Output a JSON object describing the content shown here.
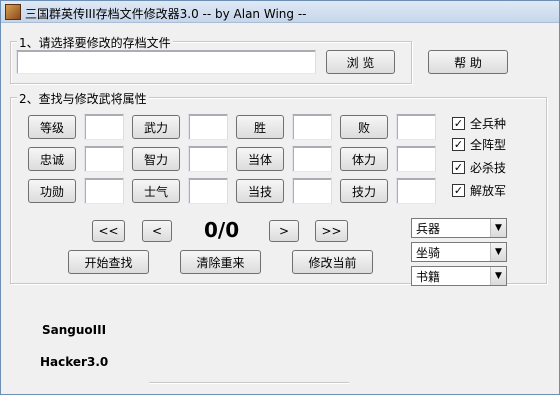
{
  "window": {
    "title": "三国群英传III存档文件修改器3.0 -- by Alan Wing --"
  },
  "file_group": {
    "legend": "1、请选择要修改的存档文件",
    "path_value": "",
    "browse_label": "浏 览",
    "help_label": "帮 助"
  },
  "search_group": {
    "legend": "2、查找与修改武将属性",
    "fields": [
      {
        "label": "等级",
        "value": ""
      },
      {
        "label": "武力",
        "value": ""
      },
      {
        "label": "胜",
        "value": ""
      },
      {
        "label": "败",
        "value": ""
      },
      {
        "label": "忠诚",
        "value": ""
      },
      {
        "label": "智力",
        "value": ""
      },
      {
        "label": "当体",
        "value": ""
      },
      {
        "label": "体力",
        "value": ""
      },
      {
        "label": "功勋",
        "value": ""
      },
      {
        "label": "士气",
        "value": ""
      },
      {
        "label": "当技",
        "value": ""
      },
      {
        "label": "技力",
        "value": ""
      }
    ],
    "checkboxes": [
      {
        "label": "全兵种",
        "checked": true
      },
      {
        "label": "全阵型",
        "checked": true
      },
      {
        "label": "必杀技",
        "checked": true
      },
      {
        "label": "解放军",
        "checked": true
      }
    ],
    "nav": {
      "first": "<<",
      "prev": "<",
      "next": ">",
      "last": ">>"
    },
    "counter": "0/0",
    "actions": {
      "search_label": "开始查找",
      "reset_label": "清除重来",
      "modify_label": "修改当前"
    },
    "selects": [
      {
        "value": "兵器"
      },
      {
        "value": "坐骑"
      },
      {
        "value": "书籍"
      }
    ]
  },
  "footer": {
    "line1": "SanguoIII",
    "line2": "Hacker3.0"
  }
}
